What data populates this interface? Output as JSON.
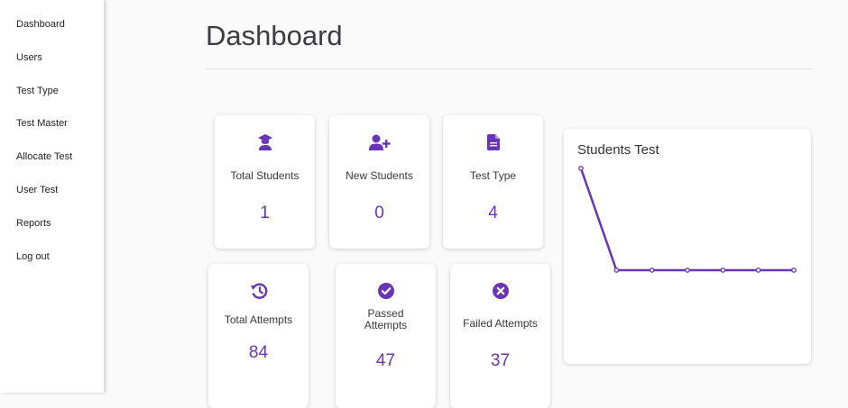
{
  "sidebar": {
    "items": [
      {
        "label": "Dashboard"
      },
      {
        "label": "Users"
      },
      {
        "label": "Test Type"
      },
      {
        "label": "Test Master"
      },
      {
        "label": "Allocate Test"
      },
      {
        "label": "User Test"
      },
      {
        "label": "Reports"
      },
      {
        "label": "Log out"
      }
    ]
  },
  "header": {
    "title": "Dashboard"
  },
  "cards": [
    {
      "label": "Total Students",
      "value": "1",
      "icon": "graduate-icon"
    },
    {
      "label": "New Students",
      "value": "0",
      "icon": "user-plus-icon"
    },
    {
      "label": "Test Type",
      "value": "4",
      "icon": "document-icon"
    },
    {
      "label": "Total Attempts",
      "value": "84",
      "icon": "history-icon"
    },
    {
      "label": "Passed Attempts",
      "value": "47",
      "icon": "check-circle-icon"
    },
    {
      "label": "Failed Attempts",
      "value": "37",
      "icon": "x-circle-icon"
    }
  ],
  "colors": {
    "accent": "#6a35b4"
  },
  "chart_data": {
    "type": "line",
    "title": "Students Test",
    "x": [
      0,
      1,
      2,
      3,
      4,
      5,
      6
    ],
    "series": [
      {
        "values": [
          3,
          0,
          0,
          0,
          0,
          0,
          0
        ]
      }
    ],
    "ylim": [
      0,
      3
    ],
    "grid": false
  }
}
